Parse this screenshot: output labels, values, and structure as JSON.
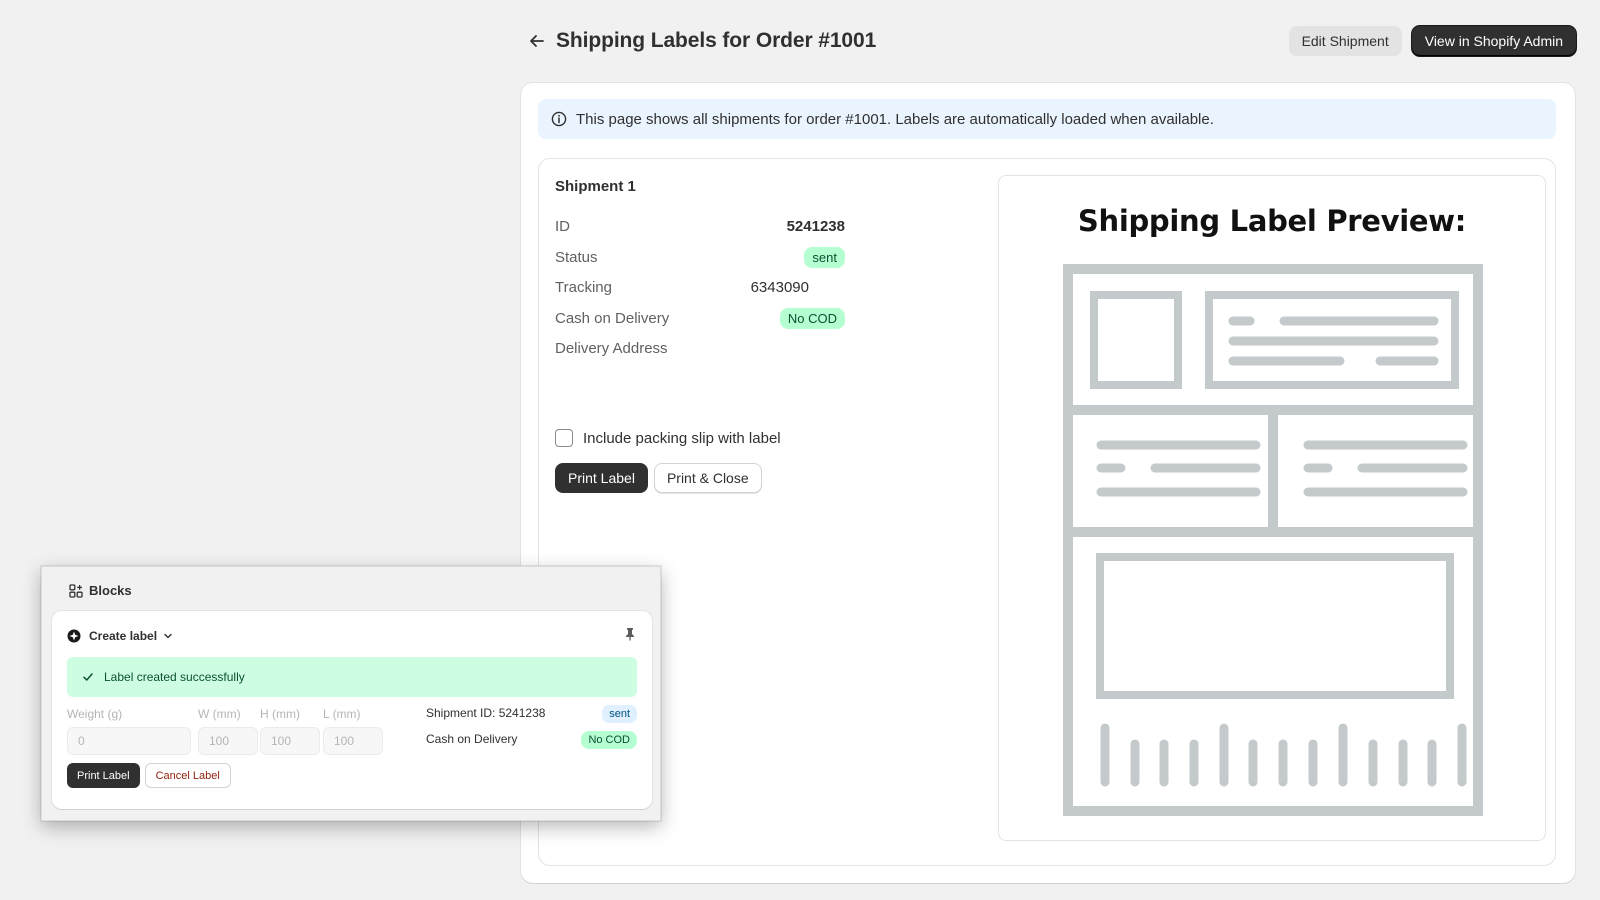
{
  "header": {
    "title": "Shipping Labels for Order #1001",
    "edit_button": "Edit Shipment",
    "admin_button": "View in Shopify Admin"
  },
  "banner": {
    "text": "This page shows all shipments for order #1001. Labels are automatically loaded when available."
  },
  "shipment": {
    "title": "Shipment 1",
    "id_label": "ID",
    "id_value": "5241238",
    "status_label": "Status",
    "status_value": "sent",
    "tracking_label": "Tracking",
    "tracking_value": "6343090",
    "cod_label": "Cash on Delivery",
    "cod_value": "No COD",
    "address_label": "Delivery Address",
    "packing_slip_label": "Include packing slip with label",
    "packing_slip_checked": false,
    "print_label_button": "Print Label",
    "print_close_button": "Print & Close"
  },
  "preview": {
    "title": "Shipping Label Preview:"
  },
  "blocks": {
    "title": "Blocks",
    "card_title": "Create label",
    "success_message": "Label created successfully",
    "fields": {
      "weight_label": "Weight (g)",
      "weight_value": "0",
      "w_label": "W (mm)",
      "w_value": "100",
      "h_label": "H (mm)",
      "h_value": "100",
      "l_label": "L (mm)",
      "l_value": "100"
    },
    "shipment_id_text": "Shipment ID: 5241238",
    "shipment_status": "sent",
    "cod_label": "Cash on Delivery",
    "cod_value": "No COD",
    "print_button": "Print Label",
    "cancel_button": "Cancel Label"
  },
  "colors": {
    "primary_button": "#303030",
    "success_badge": "#b4fed2",
    "info_banner": "#eaf4ff",
    "success_banner": "#cdfee1",
    "label_illustration": "#c4cacc"
  }
}
